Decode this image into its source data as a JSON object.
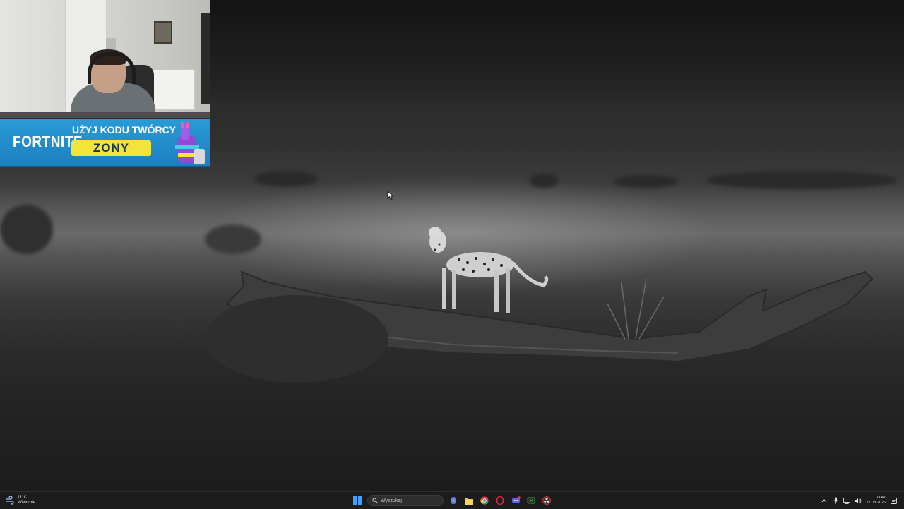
{
  "overlay": {
    "banner": {
      "brand": "FORTNITE",
      "headline": "UŻYJ KODU TWÓRCY",
      "code": "ZONY"
    }
  },
  "taskbar": {
    "weather": {
      "temperature": "11°C",
      "condition": "Wietrznie",
      "icon": "windy-icon"
    },
    "search": {
      "placeholder": "Wyszukaj"
    },
    "pinned_apps": [
      {
        "name": "start-icon",
        "color": "#3fa0ff"
      },
      {
        "name": "copilot-icon",
        "color": "#8a6cf0"
      },
      {
        "name": "file-explorer-icon",
        "color": "#f4c542"
      },
      {
        "name": "chrome-icon",
        "color": "#e44134"
      },
      {
        "name": "opera-gx-icon",
        "color": "#e0213f"
      },
      {
        "name": "discord-icon",
        "color": "#5865f2"
      },
      {
        "name": "xbox-icon",
        "color": "#3a9a3a"
      },
      {
        "name": "obs-icon",
        "color": "#cc3333"
      }
    ],
    "clock": {
      "time": "03:47",
      "date": "27.03.2026"
    }
  }
}
